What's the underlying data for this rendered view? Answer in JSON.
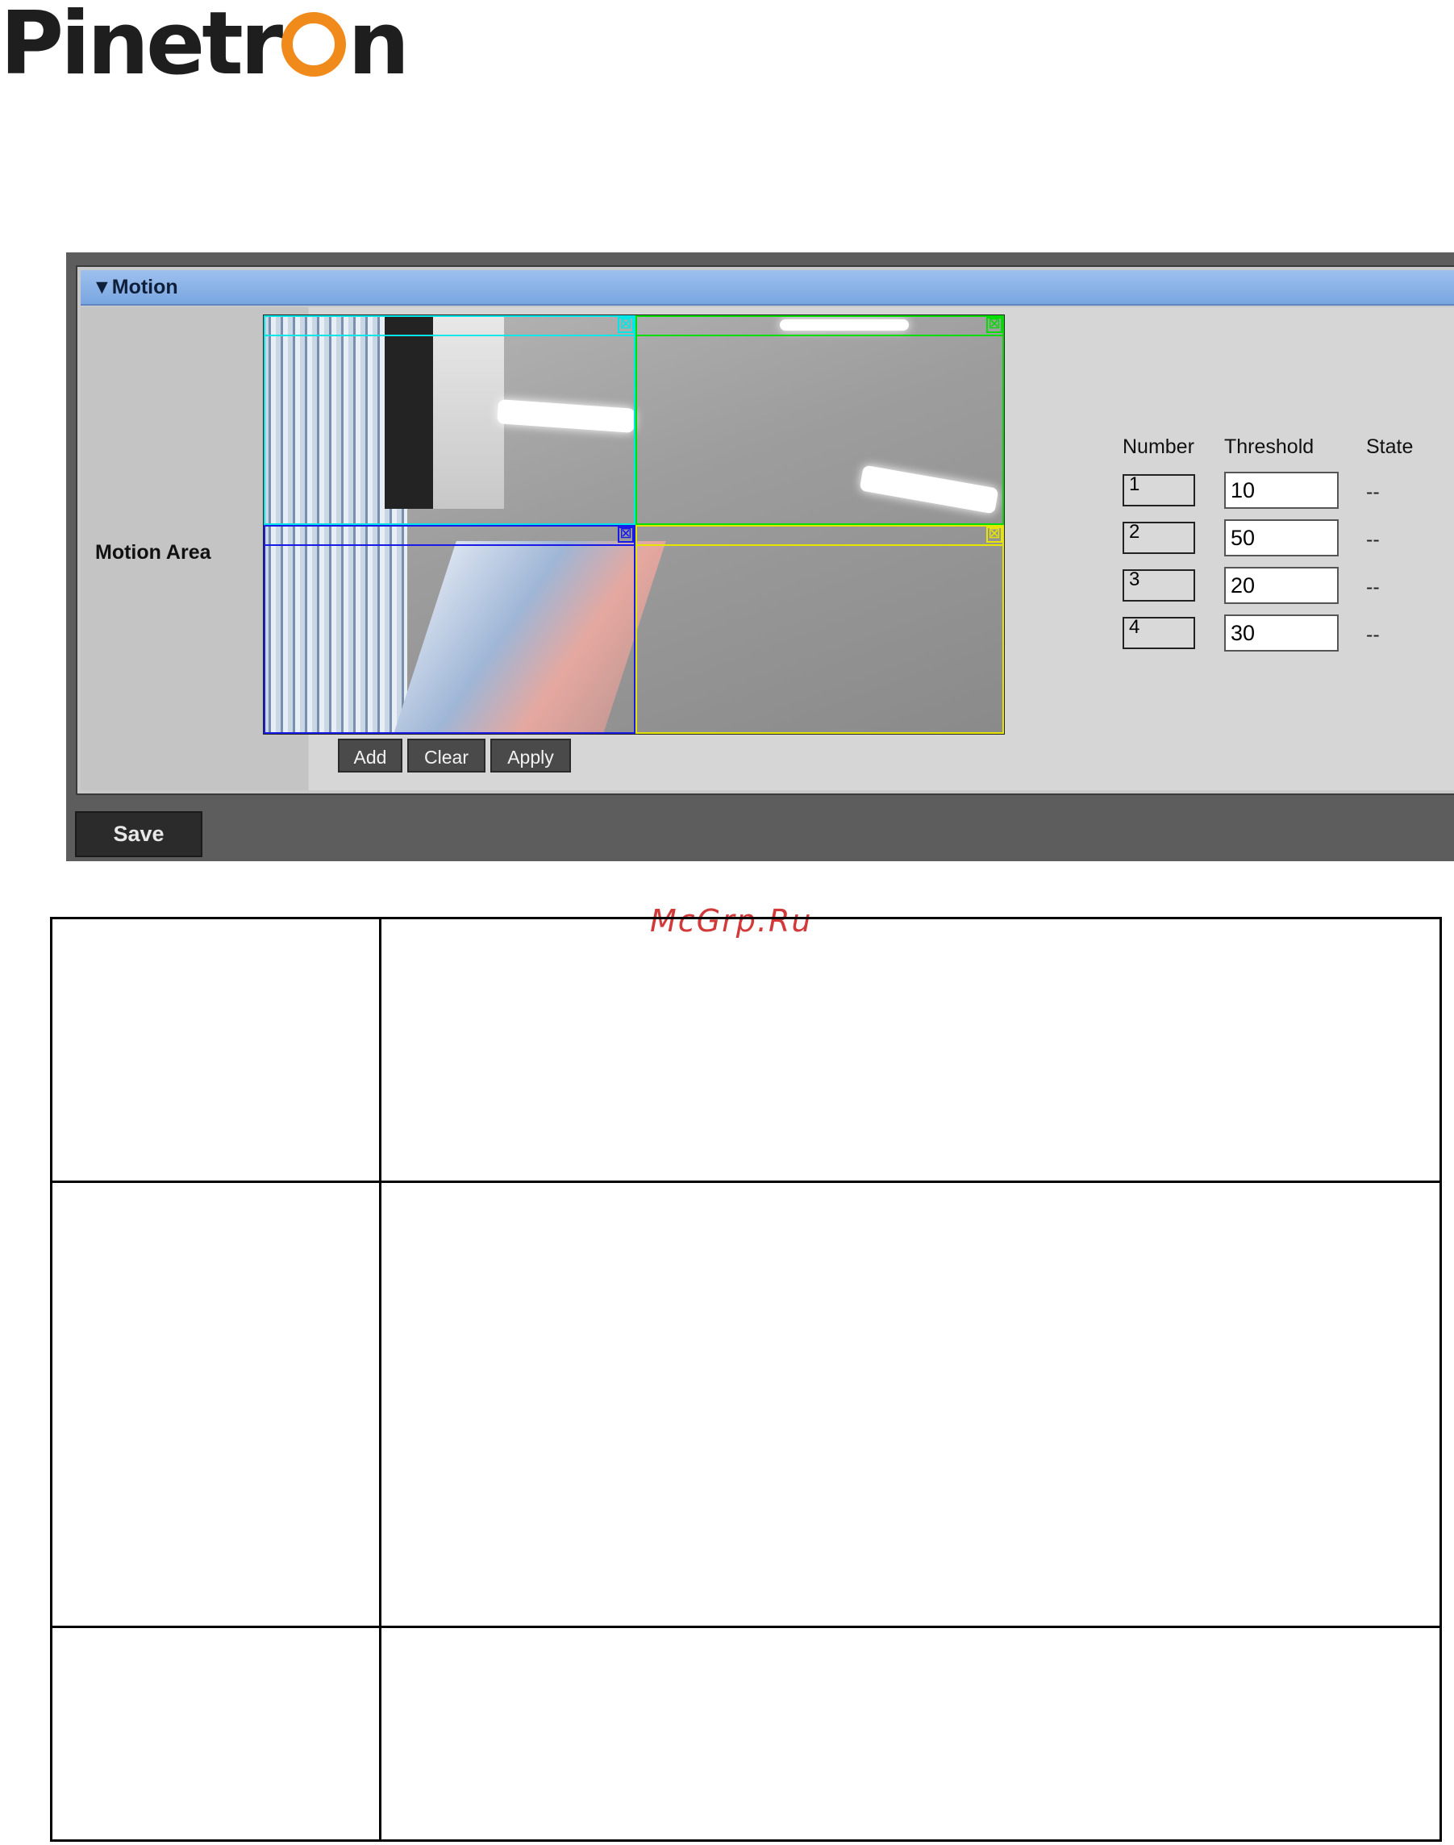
{
  "brand": {
    "logo_prefix": "Pinetr",
    "logo_suffix": "n"
  },
  "panel": {
    "header": "▼Motion",
    "field_label": "Motion Area",
    "buttons": {
      "add": "Add",
      "clear": "Clear",
      "apply": "Apply"
    },
    "table": {
      "headers": {
        "number": "Number",
        "threshold": "Threshold",
        "state": "State"
      },
      "rows": [
        {
          "number": "1",
          "threshold": "10",
          "state": "--"
        },
        {
          "number": "2",
          "threshold": "50",
          "state": "--"
        },
        {
          "number": "3",
          "threshold": "20",
          "state": "--"
        },
        {
          "number": "4",
          "threshold": "30",
          "state": "--"
        }
      ]
    },
    "zone_colors": {
      "zone1": "#00e5e5",
      "zone2": "#00dd00",
      "zone3": "#1a1ae6",
      "zone4": "#e6e600"
    },
    "close_glyph": "☒"
  },
  "footer": {
    "save_label": "Save"
  },
  "watermark": "McGrp.Ru"
}
